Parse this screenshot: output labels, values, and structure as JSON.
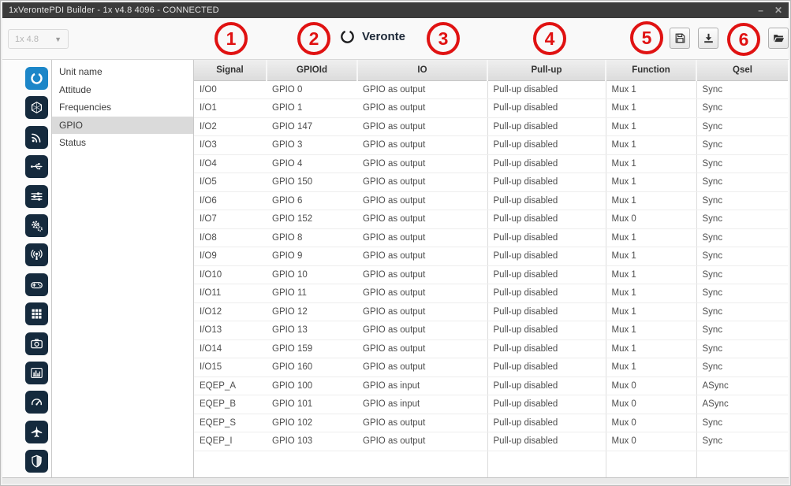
{
  "window": {
    "title": "1xVerontePDI Builder - 1x v4.8 4096 - CONNECTED",
    "minimize_glyph": "–",
    "close_glyph": "✕"
  },
  "toolbar": {
    "version_dropdown_value": "1x 4.8",
    "brand": "Veronte",
    "buttons": [
      "save",
      "download",
      "open-folder"
    ]
  },
  "annotations": {
    "labels": [
      "1",
      "2",
      "3",
      "4",
      "5",
      "6"
    ],
    "color": "#e01212"
  },
  "sidebar": {
    "icons": [
      {
        "name": "veronte-ring",
        "selected": true
      },
      {
        "name": "hexagon-network",
        "selected": false
      },
      {
        "name": "rss-signal",
        "selected": false
      },
      {
        "name": "usb",
        "selected": false
      },
      {
        "name": "sliders",
        "selected": false
      },
      {
        "name": "gears",
        "selected": false
      },
      {
        "name": "broadcast",
        "selected": false
      },
      {
        "name": "gamepad",
        "selected": false
      },
      {
        "name": "grid",
        "selected": false
      },
      {
        "name": "camera",
        "selected": false
      },
      {
        "name": "bar-chart",
        "selected": false
      },
      {
        "name": "gauge",
        "selected": false
      },
      {
        "name": "airplane",
        "selected": false
      },
      {
        "name": "shield",
        "selected": false
      }
    ]
  },
  "nav": {
    "items": [
      {
        "label": "Unit name",
        "active": false
      },
      {
        "label": "Attitude",
        "active": false
      },
      {
        "label": "Frequencies",
        "active": false
      },
      {
        "label": "GPIO",
        "active": true
      },
      {
        "label": "Status",
        "active": false
      }
    ]
  },
  "table": {
    "columns": [
      "Signal",
      "GPIOId",
      "IO",
      "Pull-up",
      "Function",
      "Qsel"
    ],
    "rows": [
      [
        "I/O0",
        "GPIO 0",
        "GPIO as output",
        "Pull-up disabled",
        "Mux 1",
        "Sync"
      ],
      [
        "I/O1",
        "GPIO 1",
        "GPIO as output",
        "Pull-up disabled",
        "Mux 1",
        "Sync"
      ],
      [
        "I/O2",
        "GPIO 147",
        "GPIO as output",
        "Pull-up disabled",
        "Mux 1",
        "Sync"
      ],
      [
        "I/O3",
        "GPIO 3",
        "GPIO as output",
        "Pull-up disabled",
        "Mux 1",
        "Sync"
      ],
      [
        "I/O4",
        "GPIO 4",
        "GPIO as output",
        "Pull-up disabled",
        "Mux 1",
        "Sync"
      ],
      [
        "I/O5",
        "GPIO 150",
        "GPIO as output",
        "Pull-up disabled",
        "Mux 1",
        "Sync"
      ],
      [
        "I/O6",
        "GPIO 6",
        "GPIO as output",
        "Pull-up disabled",
        "Mux 1",
        "Sync"
      ],
      [
        "I/O7",
        "GPIO 152",
        "GPIO as output",
        "Pull-up disabled",
        "Mux 0",
        "Sync"
      ],
      [
        "I/O8",
        "GPIO 8",
        "GPIO as output",
        "Pull-up disabled",
        "Mux 1",
        "Sync"
      ],
      [
        "I/O9",
        "GPIO 9",
        "GPIO as output",
        "Pull-up disabled",
        "Mux 1",
        "Sync"
      ],
      [
        "I/O10",
        "GPIO 10",
        "GPIO as output",
        "Pull-up disabled",
        "Mux 1",
        "Sync"
      ],
      [
        "I/O11",
        "GPIO 11",
        "GPIO as output",
        "Pull-up disabled",
        "Mux 1",
        "Sync"
      ],
      [
        "I/O12",
        "GPIO 12",
        "GPIO as output",
        "Pull-up disabled",
        "Mux 1",
        "Sync"
      ],
      [
        "I/O13",
        "GPIO 13",
        "GPIO as output",
        "Pull-up disabled",
        "Mux 1",
        "Sync"
      ],
      [
        "I/O14",
        "GPIO 159",
        "GPIO as output",
        "Pull-up disabled",
        "Mux 1",
        "Sync"
      ],
      [
        "I/O15",
        "GPIO 160",
        "GPIO as output",
        "Pull-up disabled",
        "Mux 1",
        "Sync"
      ],
      [
        "EQEP_A",
        "GPIO 100",
        "GPIO as input",
        "Pull-up disabled",
        "Mux 0",
        "ASync"
      ],
      [
        "EQEP_B",
        "GPIO 101",
        "GPIO as input",
        "Pull-up disabled",
        "Mux 0",
        "ASync"
      ],
      [
        "EQEP_S",
        "GPIO 102",
        "GPIO as output",
        "Pull-up disabled",
        "Mux 0",
        "Sync"
      ],
      [
        "EQEP_I",
        "GPIO 103",
        "GPIO as output",
        "Pull-up disabled",
        "Mux 0",
        "Sync"
      ]
    ]
  },
  "colors": {
    "titlebar": "#3b3b3b",
    "sidebar_icon": "#152a3d",
    "sidebar_selected": "#1c86c8",
    "annotation_red": "#e01212",
    "nav_active_bg": "#dadada",
    "header_bg": "#e4e4e4"
  }
}
